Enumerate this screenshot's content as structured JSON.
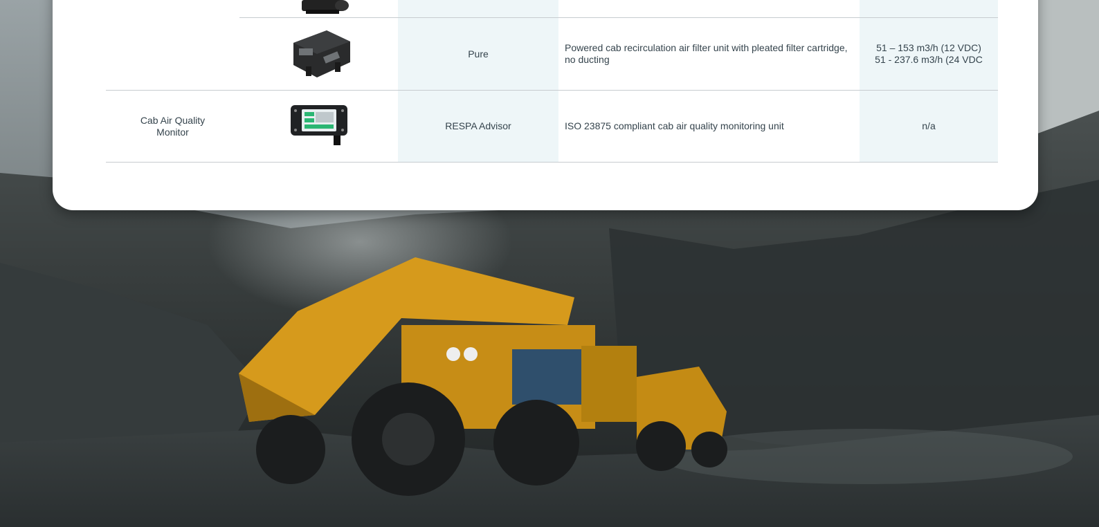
{
  "rows": [
    {
      "category": "",
      "name": "Pure",
      "description": "Powered cab recirculation air filter unit with pleated filter cartridge, no ducting",
      "flow_line1": "51 – 153 m3/h (12 VDC)",
      "flow_line2": "51 - 237.6 m3/h (24 VDC"
    },
    {
      "category": "Cab Air Quality Monitor",
      "name": "RESPA Advisor",
      "description": "ISO 23875 compliant cab air quality monitoring unit",
      "flow_line1": "n/a",
      "flow_line2": ""
    }
  ],
  "colors": {
    "highlight_column": "#eef6f8",
    "rule": "#c6cbcf",
    "truck_yellow": "#d69a1c"
  },
  "icons": [
    "filter-unit-icon",
    "air-quality-monitor-icon",
    "mining-truck-image"
  ]
}
